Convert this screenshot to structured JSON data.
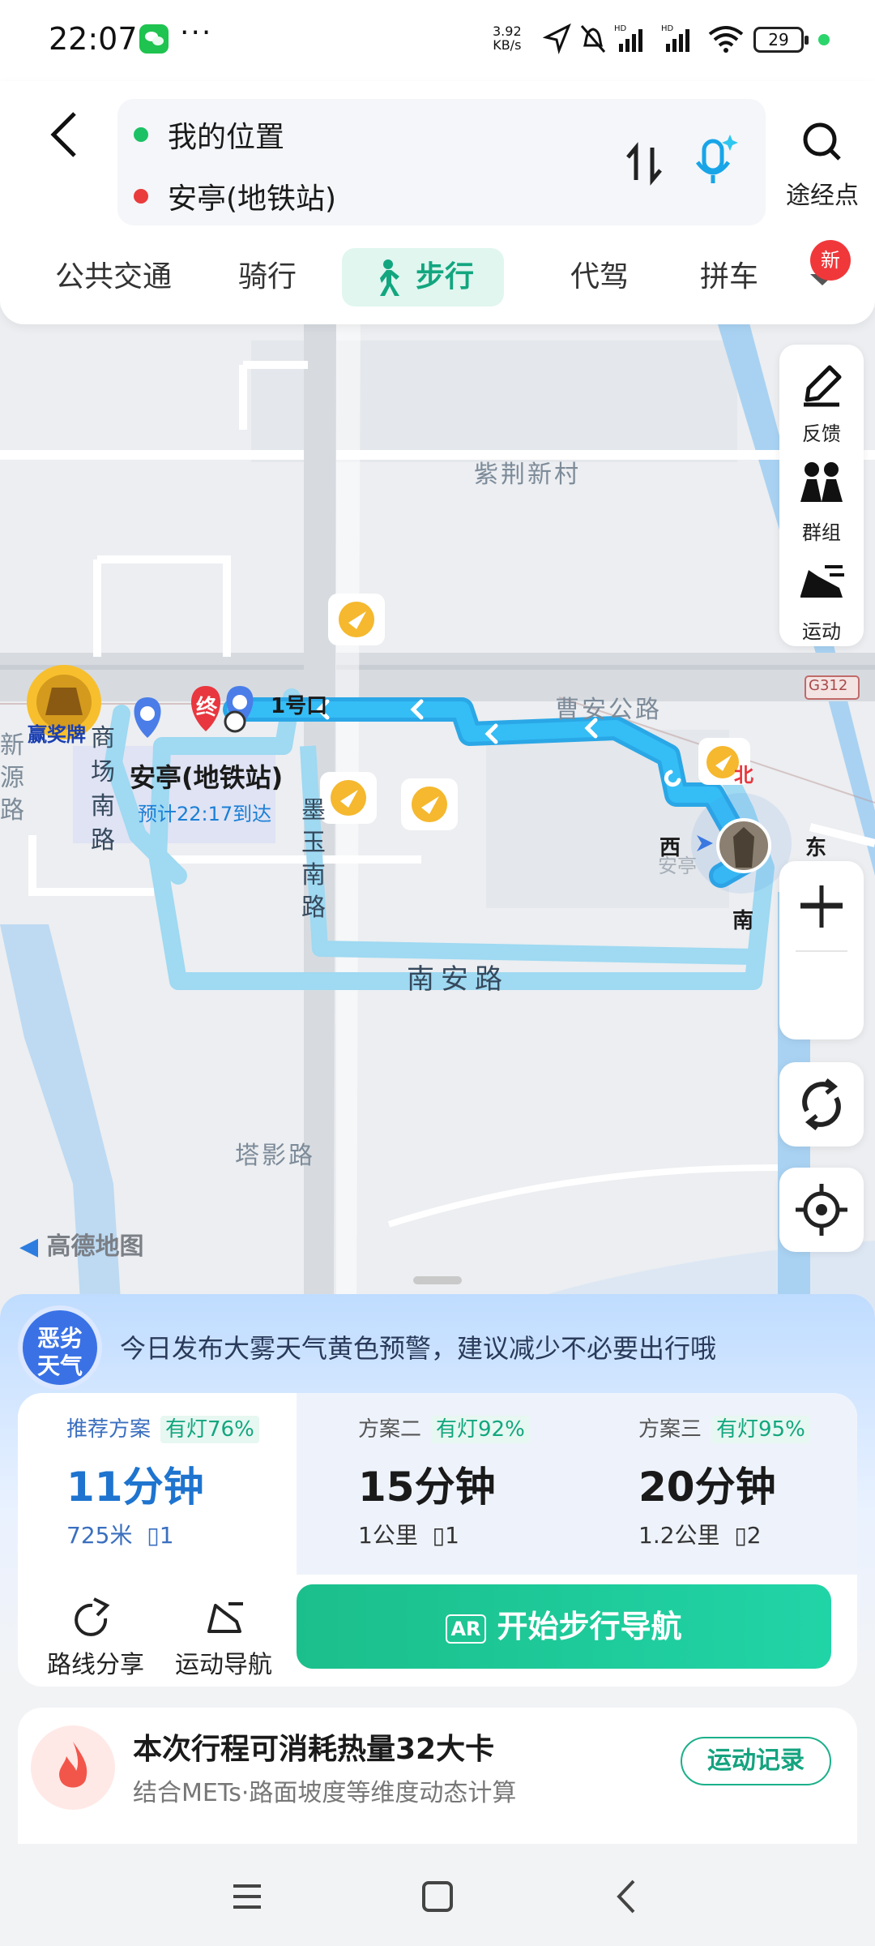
{
  "status_bar": {
    "time": "22:07",
    "dots": "···",
    "net_speed_value": "3.92",
    "net_speed_unit": "KB/s",
    "battery": "29"
  },
  "header": {
    "origin": "我的位置",
    "destination": "安亭(地铁站)",
    "waypoint_label": "途经点"
  },
  "modes": {
    "tabs": [
      "公共交通",
      "骑行",
      "步行",
      "代驾",
      "拼车"
    ],
    "active": "步行",
    "new_badge": "新"
  },
  "map": {
    "medal_label": "赢奖牌",
    "side_tools": [
      "反馈",
      "群组",
      "运动"
    ],
    "labels": {
      "village": "紫荆新村",
      "road_caoan": "曹安公路",
      "road_nanan": "南安路",
      "road_moyu": "墨玉南路",
      "road_shangchang": "商场南路",
      "road_taying": "塔影路",
      "road_xinyuan": "新源路",
      "g312": "G312",
      "exit": "1号口",
      "station": "安亭(地铁站)",
      "eta": "预计22:17到达",
      "end_marker": "终",
      "compass_n": "北",
      "compass_e": "东",
      "compass_s": "南",
      "compass_w": "西",
      "anting_faint": "安亭",
      "logo": "高德地图"
    },
    "accent_route": "#2fb8ef"
  },
  "weather": {
    "badge_top": "恶劣",
    "badge_bottom": "天气",
    "message": "今日发布大雾天气黄色预警，建议减少不必要出行哦"
  },
  "plans": [
    {
      "name": "推荐方案",
      "lights": "有灯76%",
      "time": "11分钟",
      "distance": "725米",
      "crossings": "1"
    },
    {
      "name": "方案二",
      "lights": "有灯92%",
      "time": "15分钟",
      "distance": "1公里",
      "crossings": "1"
    },
    {
      "name": "方案三",
      "lights": "有灯95%",
      "time": "20分钟",
      "distance": "1.2公里",
      "crossings": "2"
    }
  ],
  "actions": {
    "share": "路线分享",
    "sport_nav": "运动导航",
    "start": "开始步行导航"
  },
  "calorie": {
    "title": "本次行程可消耗热量32大卡",
    "subtitle": "结合METs·路面坡度等维度动态计算",
    "record_button": "运动记录"
  }
}
